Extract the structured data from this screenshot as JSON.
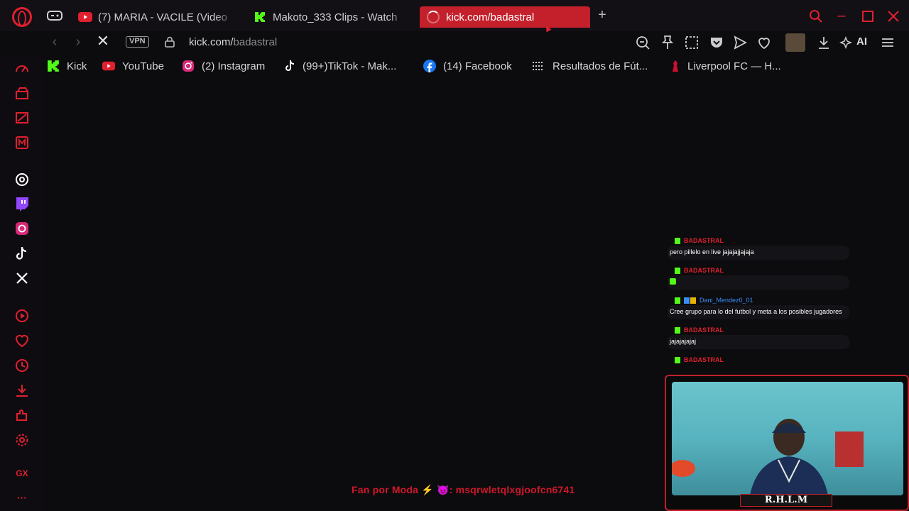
{
  "tabs": [
    {
      "title": "(7) MARIA - VACILE (Video",
      "favicon": "youtube-icon"
    },
    {
      "title": "Makoto_333 Clips - Watch",
      "favicon": "kick-icon"
    },
    {
      "title": "kick.com/badastral",
      "favicon": "loading-spinner",
      "active": true
    }
  ],
  "address": {
    "vpn_label": "VPN",
    "url_host": "kick.com/",
    "url_path": "badastral"
  },
  "toolbar": {
    "ai_label": "AI"
  },
  "bookmarks": [
    {
      "label": "Kick",
      "icon": "kick-icon"
    },
    {
      "label": "YouTube",
      "icon": "youtube-icon"
    },
    {
      "label": "(2) Instagram",
      "icon": "instagram-icon"
    },
    {
      "label": "(99+)TikTok - Mak...",
      "icon": "tiktok-icon"
    },
    {
      "label": "(14) Facebook",
      "icon": "facebook-icon"
    },
    {
      "label": "Resultados de Fút...",
      "icon": "flag-icon"
    },
    {
      "label": "Liverpool FC — H...",
      "icon": "liverpool-icon"
    }
  ],
  "sidebar": {
    "gx_label": "GX",
    "more_label": "···"
  },
  "chat": {
    "messages": [
      {
        "user": "BADASTRAL",
        "text": "pero pillelo en live jajajajjajaja"
      },
      {
        "user": "BADASTRAL",
        "text": ""
      },
      {
        "user": "Dani_Mendez0_01",
        "text": "Cree grupo para lo del futbol y meta a los posibles jugadores"
      },
      {
        "user": "BADASTRAL",
        "text": "jajajajajaj"
      },
      {
        "user": "BADASTRAL",
        "text": ""
      }
    ]
  },
  "overlay": {
    "webcam_label": "R.H.L.M",
    "footer_prefix": "Fan por Moda",
    "footer_code": ": msqrwletqlxgjoofcn6741"
  },
  "colors": {
    "accent": "#e0202e",
    "kick_green": "#53fc18",
    "active_tab": "#c4202c"
  }
}
